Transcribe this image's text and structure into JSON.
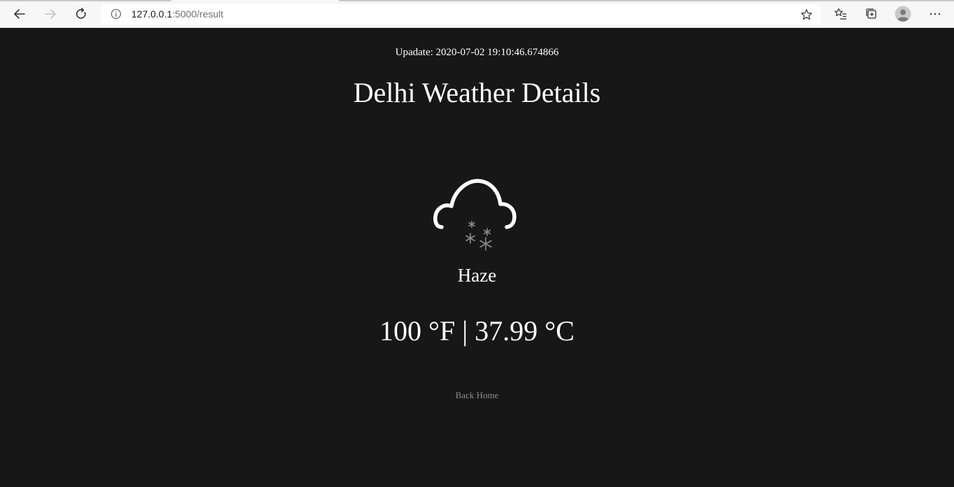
{
  "browser": {
    "url_host": "127.0.0.1",
    "url_path": ":5000/result"
  },
  "weather": {
    "updated": "Upadate: 2020-07-02 19:10:46.674866",
    "title": "Delhi Weather Details",
    "icon": "snow-cloud-icon",
    "condition": "Haze",
    "temperature": "100 °F | 37.99 °C",
    "back_link": "Back Home"
  }
}
